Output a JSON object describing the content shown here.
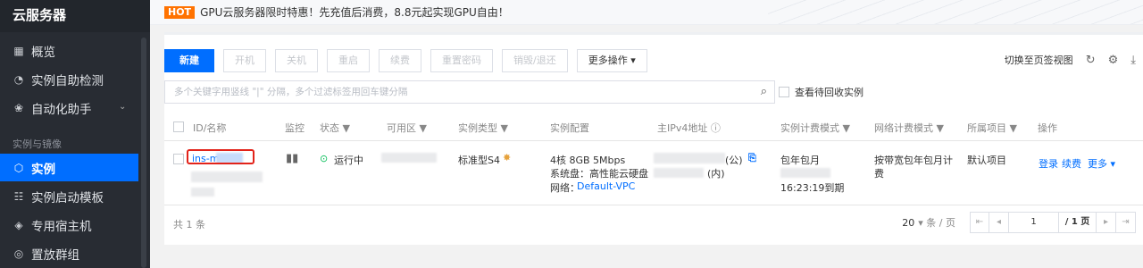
{
  "sidebar": {
    "title": "云服务器",
    "items": [
      {
        "label": "概览",
        "icon": "grid-icon"
      },
      {
        "label": "实例自助检测",
        "icon": "gauge-icon"
      },
      {
        "label": "自动化助手",
        "icon": "robot-icon"
      }
    ],
    "section_label": "实例与镜像",
    "section_items": [
      {
        "label": "实例",
        "icon": "cube-icon",
        "active": true
      },
      {
        "label": "实例启动模板",
        "icon": "template-icon"
      },
      {
        "label": "专用宿主机",
        "icon": "host-icon"
      },
      {
        "label": "置放群组",
        "icon": "group-icon"
      }
    ]
  },
  "banner": {
    "hot": "HOT",
    "text": "GPU云服务器限时特惠！先充值后消费，8.8元起实现GPU自由！"
  },
  "toolbar": {
    "buttons": [
      "新建",
      "开机",
      "关机",
      "重启",
      "续费",
      "重置密码",
      "销毁/退还",
      "更多操作 ▾"
    ],
    "switch_view": "切换至页签视图"
  },
  "search": {
    "placeholder": "多个关键字用竖线 \"|\" 分隔，多个过滤标签用回车键分隔",
    "recycle_label": "查看待回收实例"
  },
  "table": {
    "headers": [
      "ID/名称",
      "监控",
      "状态 ▼",
      "可用区 ▼",
      "实例类型 ▼",
      "实例配置",
      "主IPv4地址 ⓘ",
      "实例计费模式 ▼",
      "网络计费模式 ▼",
      "所属项目 ▼",
      "操作"
    ],
    "row": {
      "id": "ins-m",
      "status": "运行中",
      "type": "标准型S4",
      "config_line1": "4核 8GB 5Mbps",
      "config_line2": "系统盘：高性能云硬盘",
      "config_line3_label": "网络：",
      "config_line3_value": "Default-VPC",
      "ip_public_suffix": "(公)",
      "ip_private_suffix": "(内)",
      "billing": "包年包月",
      "billing_expire": "16:23:19到期",
      "net_billing_1": "按带宽包年包月计",
      "net_billing_2": "费",
      "project": "默认项目",
      "actions": [
        "登录",
        "续费",
        "更多 ▾"
      ]
    }
  },
  "footer": {
    "total": "共 1 条",
    "page_size": "20",
    "page_size_unit": "▾ 条 / 页",
    "page_input": "1",
    "page_total": "/ 1 页"
  },
  "colors": {
    "accent": "#006eff",
    "sidebar": "#282c33",
    "hot": "#ff7200",
    "highlight": "#e2231a",
    "running": "#0abf5b"
  }
}
